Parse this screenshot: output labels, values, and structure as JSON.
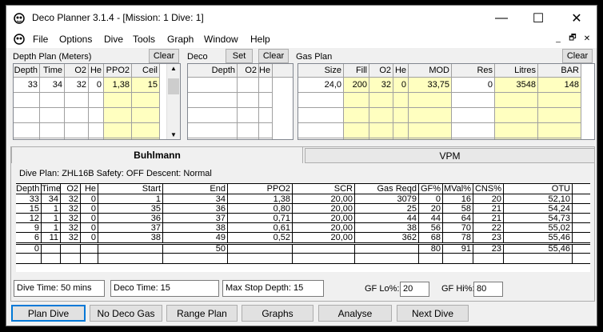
{
  "title": "Deco Planner 3.1.4 - [Mission: 1 Dive: 1]",
  "window_buttons": {
    "minimize": "—",
    "maximize": "☐",
    "close": "✕"
  },
  "menu": [
    "File",
    "Options",
    "Dive",
    "Tools",
    "Graph",
    "Window",
    "Help"
  ],
  "mdi_buttons": [
    "_",
    "🗗",
    "✕"
  ],
  "depth_plan": {
    "label": "Depth Plan (Meters)",
    "clear": "Clear",
    "headers": [
      "Depth",
      "Time",
      "O2",
      "He",
      "PPO2",
      "Ceil"
    ],
    "rows": [
      [
        "33",
        "34",
        "32",
        "0",
        "1,38",
        "15"
      ]
    ]
  },
  "deco": {
    "label": "Deco",
    "set": "Set",
    "clear": "Clear",
    "headers": [
      "Depth",
      "O2",
      "He"
    ]
  },
  "gas_plan": {
    "label": "Gas Plan",
    "clear": "Clear",
    "headers": [
      "Size",
      "Fill",
      "O2",
      "He",
      "MOD",
      "Res",
      "Litres",
      "BAR"
    ],
    "rows": [
      [
        "24,0",
        "200",
        "32",
        "0",
        "33,75",
        "0",
        "3548",
        "148"
      ]
    ]
  },
  "tabs": [
    "Buhlmann",
    "VPM"
  ],
  "dive_info": "Dive Plan: ZHL16B  Safety: OFF  Descent: Normal",
  "results": {
    "headers": [
      "Depth",
      "Time",
      "O2",
      "He",
      "Start",
      "End",
      "PPO2",
      "SCR",
      "Gas Reqd",
      "GF%",
      "MVal%",
      "CNS%",
      "OTU"
    ],
    "rows": [
      [
        "33",
        "34",
        "32",
        "0",
        "1",
        "34",
        "1,38",
        "20,00",
        "3079",
        "0",
        "16",
        "20",
        "52,10"
      ],
      [
        "15",
        "1",
        "32",
        "0",
        "35",
        "36",
        "0,80",
        "20,00",
        "25",
        "20",
        "58",
        "21",
        "54,24"
      ],
      [
        "12",
        "1",
        "32",
        "0",
        "36",
        "37",
        "0,71",
        "20,00",
        "44",
        "44",
        "64",
        "21",
        "54,73"
      ],
      [
        "9",
        "1",
        "32",
        "0",
        "37",
        "38",
        "0,61",
        "20,00",
        "38",
        "56",
        "70",
        "22",
        "55,02"
      ],
      [
        "6",
        "11",
        "32",
        "0",
        "38",
        "49",
        "0,52",
        "20,00",
        "362",
        "68",
        "78",
        "23",
        "55,46"
      ],
      [
        "0",
        "",
        "",
        "",
        "",
        "50",
        "",
        "",
        "",
        "80",
        "91",
        "23",
        "55,46"
      ]
    ]
  },
  "summary": {
    "dive_time": "Dive Time: 50 mins",
    "deco_time": "Deco Time: 15",
    "max_stop": "Max Stop Depth: 15",
    "gf_lo_label": "GF Lo%:",
    "gf_lo": "20",
    "gf_hi_label": "GF Hi%:",
    "gf_hi": "80"
  },
  "bottom_buttons": [
    "Plan Dive",
    "No Deco Gas",
    "Range Plan",
    "Graphs",
    "Analyse",
    "Next Dive"
  ]
}
